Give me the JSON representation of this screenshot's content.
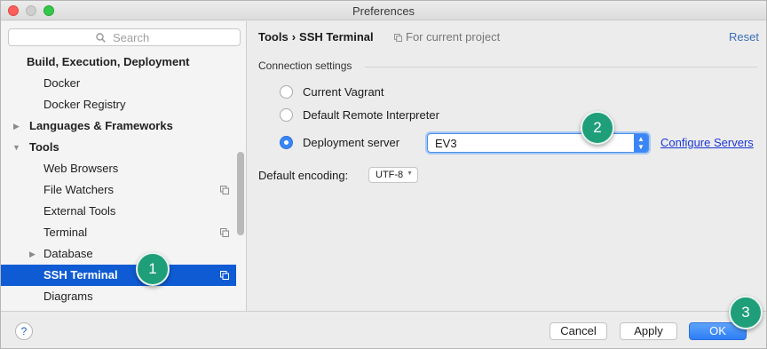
{
  "window": {
    "title": "Preferences"
  },
  "sidebar": {
    "search_placeholder": "Search",
    "items": [
      {
        "label": "Build, Execution, Deployment",
        "level": 0,
        "bold": true
      },
      {
        "label": "Docker",
        "level": 1
      },
      {
        "label": "Docker Registry",
        "level": 1
      },
      {
        "label": "Languages & Frameworks",
        "level": 0,
        "bold": true,
        "arrow": "right"
      },
      {
        "label": "Tools",
        "level": 0,
        "bold": true,
        "arrow": "down"
      },
      {
        "label": "Web Browsers",
        "level": 1
      },
      {
        "label": "File Watchers",
        "level": 1,
        "copy_icon": true
      },
      {
        "label": "External Tools",
        "level": 1
      },
      {
        "label": "Terminal",
        "level": 1,
        "copy_icon": true
      },
      {
        "label": "Database",
        "level": 1,
        "arrow": "right"
      },
      {
        "label": "SSH Terminal",
        "level": 1,
        "copy_icon": true,
        "selected": true
      },
      {
        "label": "Diagrams",
        "level": 1
      }
    ]
  },
  "main": {
    "breadcrumb": {
      "parent": "Tools",
      "separator": "›",
      "current": "SSH Terminal"
    },
    "scope_label": "For current project",
    "reset_label": "Reset",
    "connection": {
      "title": "Connection settings",
      "options": [
        {
          "label": "Current Vagrant",
          "selected": false
        },
        {
          "label": "Default Remote Interpreter",
          "selected": false
        },
        {
          "label": "Deployment server",
          "selected": true
        }
      ],
      "server_value": "EV3",
      "configure_label": "Configure Servers"
    },
    "encoding": {
      "label": "Default encoding:",
      "value": "UTF-8"
    }
  },
  "footer": {
    "help_label": "?",
    "cancel_label": "Cancel",
    "apply_label": "Apply",
    "ok_label": "OK"
  },
  "annotations": [
    "1",
    "2",
    "3"
  ],
  "colors": {
    "selection": "#0f5bd3",
    "accent": "#3b86f7",
    "link": "#1a37d6",
    "annotation_bubble": "#1f9e7a"
  }
}
